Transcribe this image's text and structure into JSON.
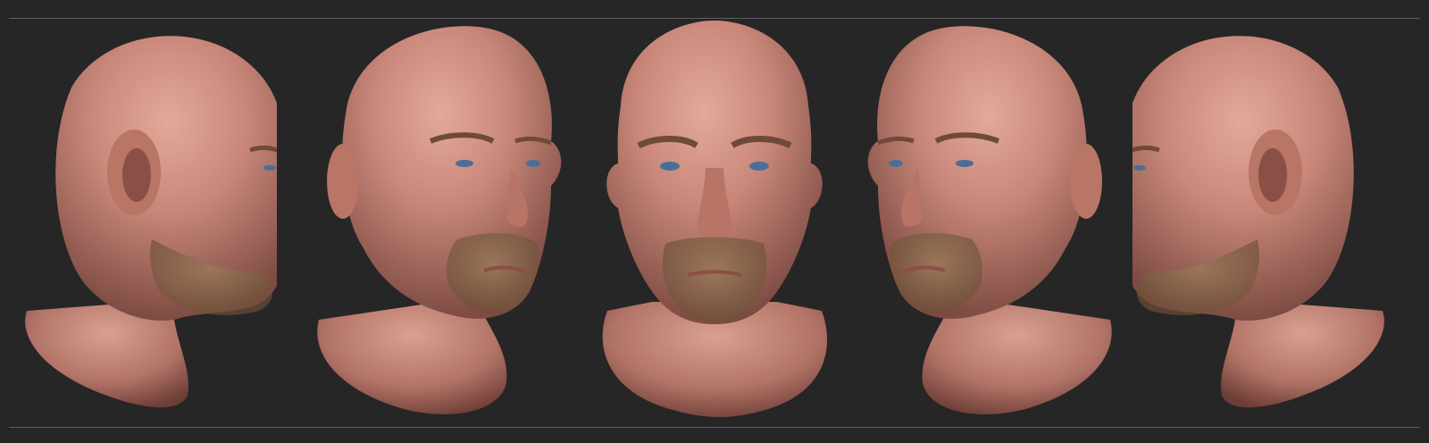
{
  "image": {
    "subject": "",
    "background_color": "#262626",
    "rule_color": "#5e5e5e",
    "skin_color": "#c9877a",
    "beard_color": "#8a6a4e",
    "eye_color": "#4a6f96",
    "views": [
      {
        "id": "left-profile",
        "icon": "head-left-profile"
      },
      {
        "id": "three-quarter-right",
        "icon": "head-three-quarter-right"
      },
      {
        "id": "front",
        "icon": "head-front"
      },
      {
        "id": "three-quarter-left",
        "icon": "head-three-quarter-left"
      },
      {
        "id": "right-profile",
        "icon": "head-right-profile"
      }
    ]
  }
}
